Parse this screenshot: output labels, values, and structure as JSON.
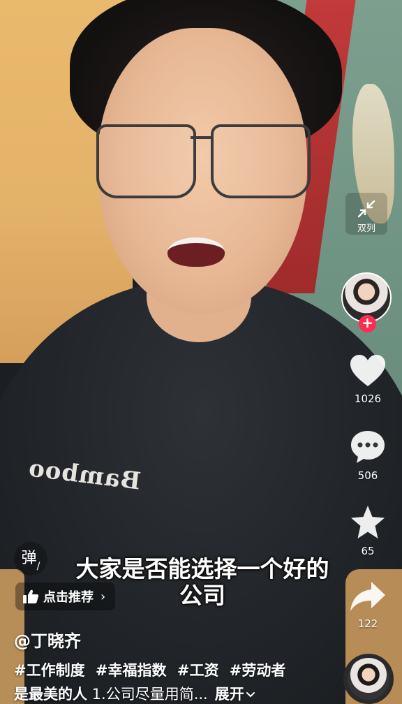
{
  "duet": {
    "label": "双列",
    "icon": "collapse-arrows-icon"
  },
  "creator": {
    "avatar_icon": "creator-avatar",
    "follow_symbol": "+"
  },
  "actions": {
    "like_count": "1026",
    "comment_count": "506",
    "favorite_count": "65",
    "share_count": "122"
  },
  "danmu": {
    "label": "弹",
    "slash": "/"
  },
  "recommend": {
    "label": "点击推荐",
    "chevron": "›"
  },
  "subtitle": {
    "line1": "大家是否能选择一个好的",
    "line2": "公司"
  },
  "shirt_text": "Bamboo",
  "author": "@丁晓齐",
  "hashtags": [
    "#工作制度",
    "#幸福指数",
    "#工资",
    "#劳动者"
  ],
  "desc": {
    "hashtag_cont": "是最美的人",
    "body": " 1.公司尽量用简...",
    "expand": "展开"
  },
  "colors": {
    "accent": "#fe2c55",
    "text": "#ffffff"
  }
}
